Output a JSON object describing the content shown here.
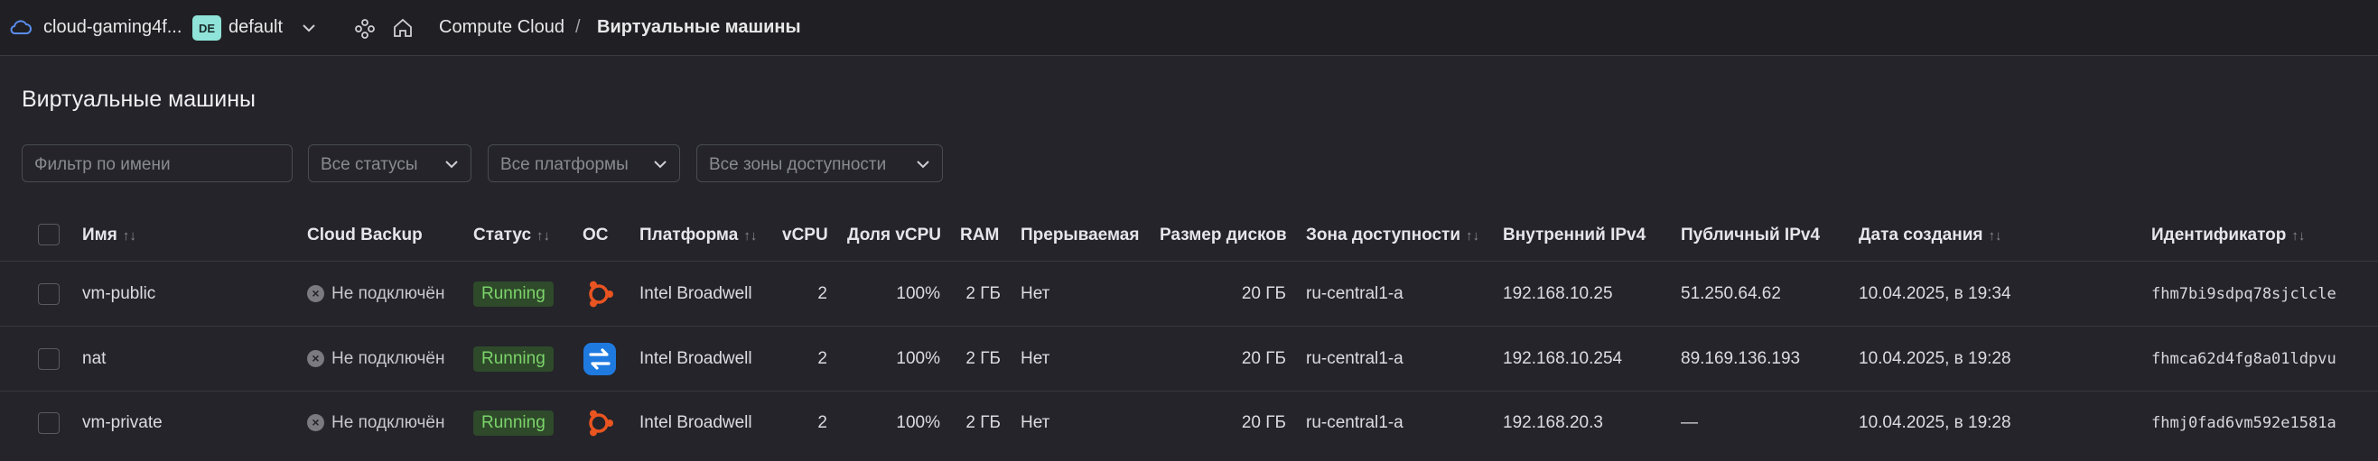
{
  "topbar": {
    "cloud_name": "cloud-gaming4f...",
    "folder_badge": "DE",
    "folder_name": "default",
    "breadcrumb": [
      "Compute Cloud",
      "/",
      "Виртуальные машины"
    ]
  },
  "page": {
    "title": "Виртуальные машины"
  },
  "filters": {
    "name_placeholder": "Фильтр по имени",
    "status": "Все статусы",
    "platform": "Все платформы",
    "zone": "Все зоны доступности"
  },
  "table": {
    "columns": {
      "name": "Имя",
      "backup": "Cloud Backup",
      "status": "Статус",
      "os": "ОС",
      "platform": "Платформа",
      "vcpu": "vCPU",
      "vcpu_share": "Доля vCPU",
      "ram": "RAM",
      "preemptible": "Прерываемая",
      "disk": "Размер дисков",
      "zone": "Зона доступности",
      "ipv4_int": "Внутренний IPv4",
      "ipv4_pub": "Публичный IPv4",
      "created": "Дата создания",
      "id": "Идентификатор"
    },
    "rows": [
      {
        "name": "vm-public",
        "backup": "Не подключён",
        "status": "Running",
        "os": "ubuntu-icon",
        "platform": "Intel Broadwell",
        "vcpu": "2",
        "vcpu_share": "100%",
        "ram": "2 ГБ",
        "preemptible": "Нет",
        "disk": "20 ГБ",
        "zone": "ru-central1-a",
        "ipv4_int": "192.168.10.25",
        "ipv4_pub": "51.250.64.62",
        "created": "10.04.2025, в 19:34",
        "id": "fhm7bi9sdpq78sjclcle"
      },
      {
        "name": "nat",
        "backup": "Не подключён",
        "status": "Running",
        "os": "nat-instance-icon",
        "platform": "Intel Broadwell",
        "vcpu": "2",
        "vcpu_share": "100%",
        "ram": "2 ГБ",
        "preemptible": "Нет",
        "disk": "20 ГБ",
        "zone": "ru-central1-a",
        "ipv4_int": "192.168.10.254",
        "ipv4_pub": "89.169.136.193",
        "created": "10.04.2025, в 19:28",
        "id": "fhmca62d4fg8a01ldpvu"
      },
      {
        "name": "vm-private",
        "backup": "Не подключён",
        "status": "Running",
        "os": "ubuntu-icon",
        "platform": "Intel Broadwell",
        "vcpu": "2",
        "vcpu_share": "100%",
        "ram": "2 ГБ",
        "preemptible": "Нет",
        "disk": "20 ГБ",
        "zone": "ru-central1-a",
        "ipv4_int": "192.168.20.3",
        "ipv4_pub": "—",
        "created": "10.04.2025, в 19:28",
        "id": "fhmj0fad6vm592e1581a"
      }
    ]
  },
  "colors": {
    "background": "#24242a",
    "status_running_bg": "#2e4a2a",
    "status_running_fg": "#7cd36a",
    "ubuntu": "#e95420",
    "nat_icon": "#1f7ae0"
  }
}
